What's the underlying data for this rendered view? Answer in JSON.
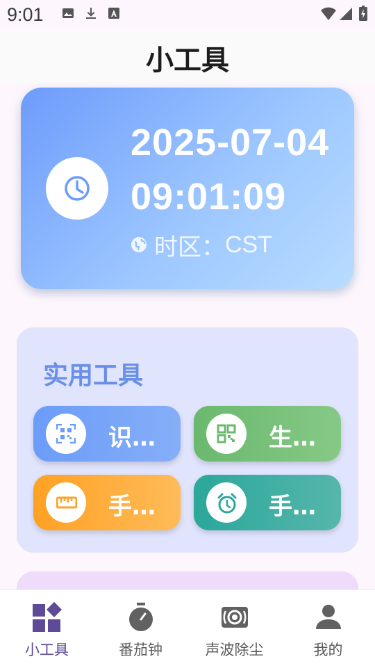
{
  "status_bar": {
    "time": "9:01",
    "left_icons": [
      "image-icon",
      "download-icon",
      "text-a-icon"
    ],
    "right_icons": [
      "wifi-icon",
      "cellular-signal-icon",
      "battery-icon"
    ]
  },
  "header": {
    "title": "小工具"
  },
  "time_card": {
    "icon": "clock-icon",
    "datetime": "2025-07-04 09:01:09",
    "timezone_icon": "globe-icon",
    "timezone_label": "时区：",
    "timezone_value": "CST",
    "gradient": [
      "#6d9bfb",
      "#b8ddff"
    ]
  },
  "tools_section": {
    "title": "实用工具",
    "tools": [
      {
        "label": "识…",
        "icon": "qr-scan-icon",
        "color": "#6b9cf8"
      },
      {
        "label": "生…",
        "icon": "qr-code-icon",
        "color": "#6ab86e"
      },
      {
        "label": "手…",
        "icon": "ruler-icon",
        "color": "#ffa124"
      },
      {
        "label": "手…",
        "icon": "alarm-clock-icon",
        "color": "#2ba79a"
      }
    ]
  },
  "bottom_nav": {
    "items": [
      {
        "label": "小工具",
        "icon": "widgets-icon",
        "active": true
      },
      {
        "label": "番茄钟",
        "icon": "stopwatch-icon",
        "active": false
      },
      {
        "label": "声波除尘",
        "icon": "speaker-icon",
        "active": false
      },
      {
        "label": "我的",
        "icon": "person-icon",
        "active": false
      }
    ]
  },
  "colors": {
    "accent": "#5e4a96",
    "section_title": "#6a8fe8",
    "panel_bg": "#e0e4fc"
  }
}
